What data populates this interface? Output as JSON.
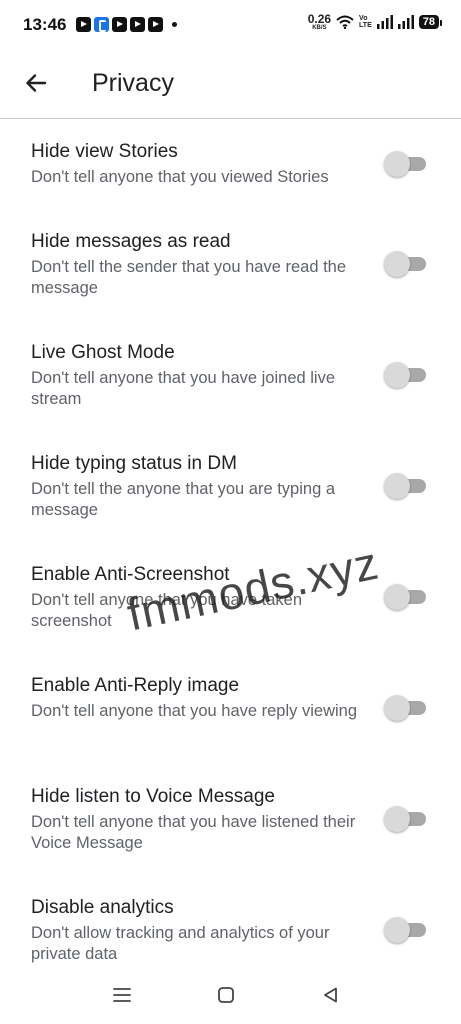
{
  "status_bar": {
    "time": "13:46",
    "net_speed_value": "0.26",
    "net_speed_unit": "KB/S",
    "volte_top": "Vo",
    "volte_bottom": "LTE",
    "battery": "78"
  },
  "header": {
    "title": "Privacy",
    "back_icon": "arrow-back-icon"
  },
  "settings": [
    {
      "title": "Hide view Stories",
      "description": "Don't tell anyone that you viewed Stories",
      "enabled": false
    },
    {
      "title": "Hide messages as read",
      "description": "Don't tell the sender that you have read the message",
      "enabled": false
    },
    {
      "title": "Live Ghost Mode",
      "description": "Don't tell anyone that you have joined live stream",
      "enabled": false
    },
    {
      "title": "Hide typing status in DM",
      "description": "Don't tell the anyone that you are typing a message",
      "enabled": false
    },
    {
      "title": "Enable Anti-Screenshot",
      "description": "Don't tell anyone that you have taken screenshot",
      "enabled": false
    },
    {
      "title": "Enable Anti-Reply image",
      "description": "Don't tell anyone that you have reply viewing",
      "enabled": false
    },
    {
      "title": "Hide listen to Voice Message",
      "description": "Don't tell anyone that you have listened their Voice Message",
      "enabled": false
    },
    {
      "title": "Disable analytics",
      "description": "Don't allow tracking and analytics of your private data",
      "enabled": false
    }
  ],
  "watermark": "fmmods.xyz",
  "nav_bar": {
    "icons": [
      "menu-icon",
      "home-square-icon",
      "back-triangle-icon"
    ]
  },
  "colors": {
    "toggle_track_off": "#a8a8a8",
    "toggle_thumb_off": "#d9d9d9",
    "title_text": "#202124",
    "description_text": "#5f6368"
  }
}
